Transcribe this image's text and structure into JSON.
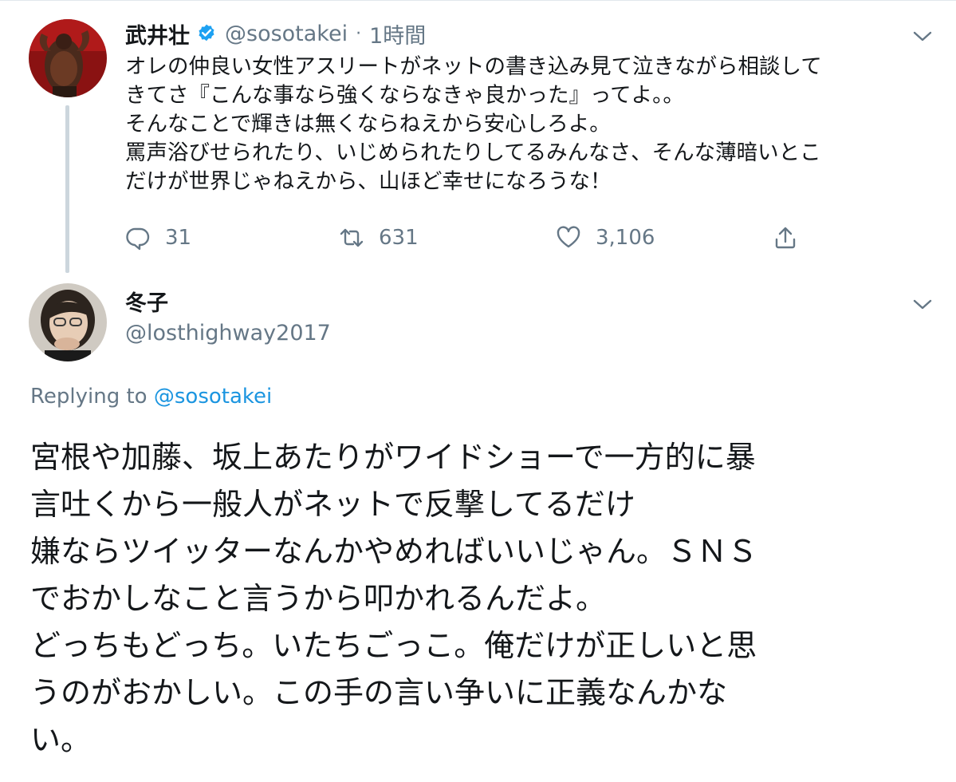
{
  "tweet1": {
    "name": "武井壮",
    "handle": "@sosotakei",
    "separator": "·",
    "time": "1時間",
    "text_lines": [
      "オレの仲良い女性アスリートがネットの書き込み見て泣きながら相談して",
      "きてさ『こんな事なら強くならなきゃ良かった』ってよ。。",
      "そんなことで輝きは無くならねえから安心しろよ。",
      "罵声浴びせられたり、いじめられたりしてるみんなさ、そんな薄暗いとこ",
      "だけが世界じゃねえから、山ほど幸せになろうな！"
    ],
    "replies": "31",
    "retweets": "631",
    "likes": "3,106"
  },
  "tweet2": {
    "name": "冬子",
    "handle": "@losthighway2017",
    "replying_prefix": "Replying to",
    "replying_to": "@sosotakei",
    "text_lines": [
      "宮根や加藤、坂上あたりがワイドショーで一方的に暴",
      "言吐くから一般人がネットで反撃してるだけ",
      "嫌ならツイッターなんかやめればいいじゃん。ＳＮＳ",
      "でおかしなこと言うから叩かれるんだよ。",
      "どっちもどっち。いたちごっこ。俺だけが正しいと思",
      "うのがおかしい。この手の言い争いに正義なんかな",
      "い。"
    ]
  },
  "icons": {
    "verified": "verified-badge-icon",
    "reply": "reply-icon",
    "retweet": "retweet-icon",
    "like": "heart-icon",
    "share": "share-icon",
    "caret": "chevron-down-icon"
  },
  "colors": {
    "text": "#14171a",
    "secondary": "#657786",
    "link": "#1b95e0",
    "verified": "#1da1f2",
    "thread_line": "#ccd6dd"
  }
}
